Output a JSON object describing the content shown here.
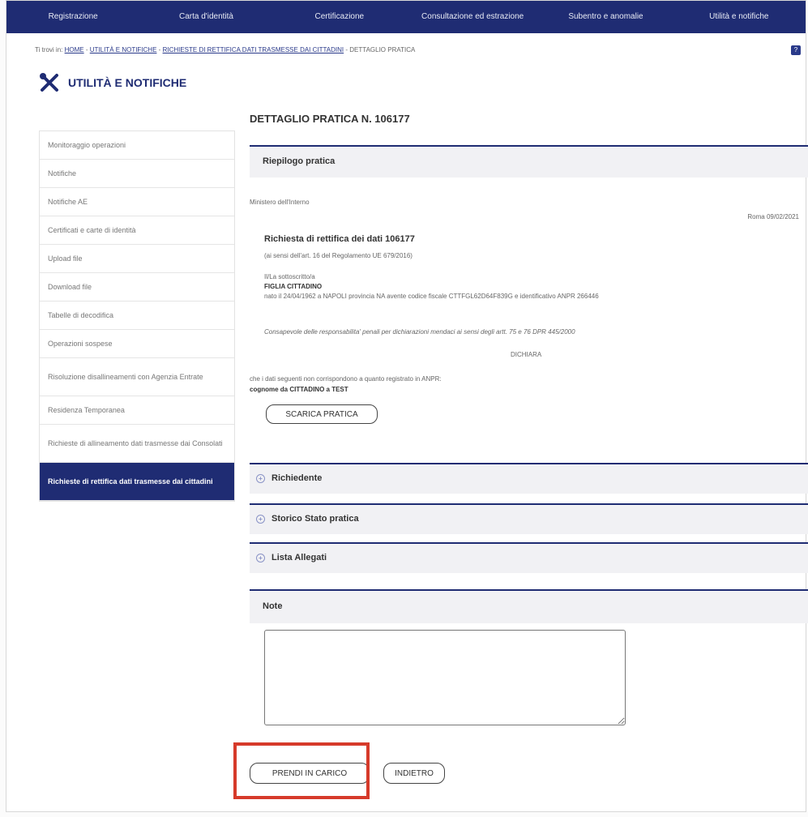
{
  "nav": [
    "Registrazione",
    "Carta d'identità",
    "Certificazione",
    "Consultazione ed estrazione",
    "Subentro e anomalie",
    "Utilità e notifiche"
  ],
  "breadcrumb": {
    "prefix": "Ti trovi in:",
    "home": "HOME",
    "level1": "UTILITÀ E NOTIFICHE",
    "level2": "RICHIESTE DI RETTIFICA DATI TRASMESSE DAI CITTADINI",
    "current": "DETTAGLIO PRATICA",
    "separator": "-"
  },
  "help_label": "?",
  "section_title": "UTILITÀ E NOTIFICHE",
  "sidebar": [
    {
      "label": "Monitoraggio operazioni",
      "active": false
    },
    {
      "label": "Notifiche",
      "active": false
    },
    {
      "label": "Notifiche AE",
      "active": false
    },
    {
      "label": "Certificati e carte di identità",
      "active": false
    },
    {
      "label": "Upload file",
      "active": false
    },
    {
      "label": "Download file",
      "active": false
    },
    {
      "label": "Tabelle di decodifica",
      "active": false
    },
    {
      "label": "Operazioni sospese",
      "active": false
    },
    {
      "label": "Risoluzione disallineamenti con Agenzia Entrate",
      "active": false
    },
    {
      "label": "Residenza Temporanea",
      "active": false
    },
    {
      "label": "Richieste di allineamento dati trasmesse dai Consolati",
      "active": false
    },
    {
      "label": "Richieste di rettifica dati trasmesse dai cittadini",
      "active": true
    }
  ],
  "page_title": "DETTAGLIO PRATICA N. 106177",
  "riepilogo": {
    "title": "Riepilogo pratica",
    "ministry": "Ministero dell'Interno",
    "place_date": "Roma 09/02/2021",
    "heading": "Richiesta di rettifica dei dati 106177",
    "subheading": "(ai sensi dell'art. 16 del Regolamento UE 679/2016)",
    "signer_intro": "Il/La sottoscritto/a",
    "signer_name": "FIGLIA CITTADINO",
    "signer_details": "nato il 24/04/1962 a NAPOLI provincia NA avente codice fiscale CTTFGL62D64F839G e identificativo ANPR 266446",
    "awareness": "Consapevole delle responsabilita' penali per dichiarazioni mendaci ai sensi degli artt. 75 e 76 DPR 445/2000",
    "declare": "DICHIARA",
    "data_mismatch": "che i dati seguenti non corrispondono a quanto registrato in ANPR:",
    "change": "cognome da CITTADINO a TEST",
    "download_button": "SCARICA PRATICA"
  },
  "collapsibles": [
    {
      "label": "Richiedente",
      "icon": "plus-circle-icon"
    },
    {
      "label": "Storico Stato pratica",
      "icon": "plus-circle-icon"
    },
    {
      "label": "Lista Allegati",
      "icon": "plus-circle-icon"
    }
  ],
  "note": {
    "title": "Note",
    "value": ""
  },
  "actions": {
    "take_charge": "PRENDI IN CARICO",
    "back": "INDIETRO"
  }
}
